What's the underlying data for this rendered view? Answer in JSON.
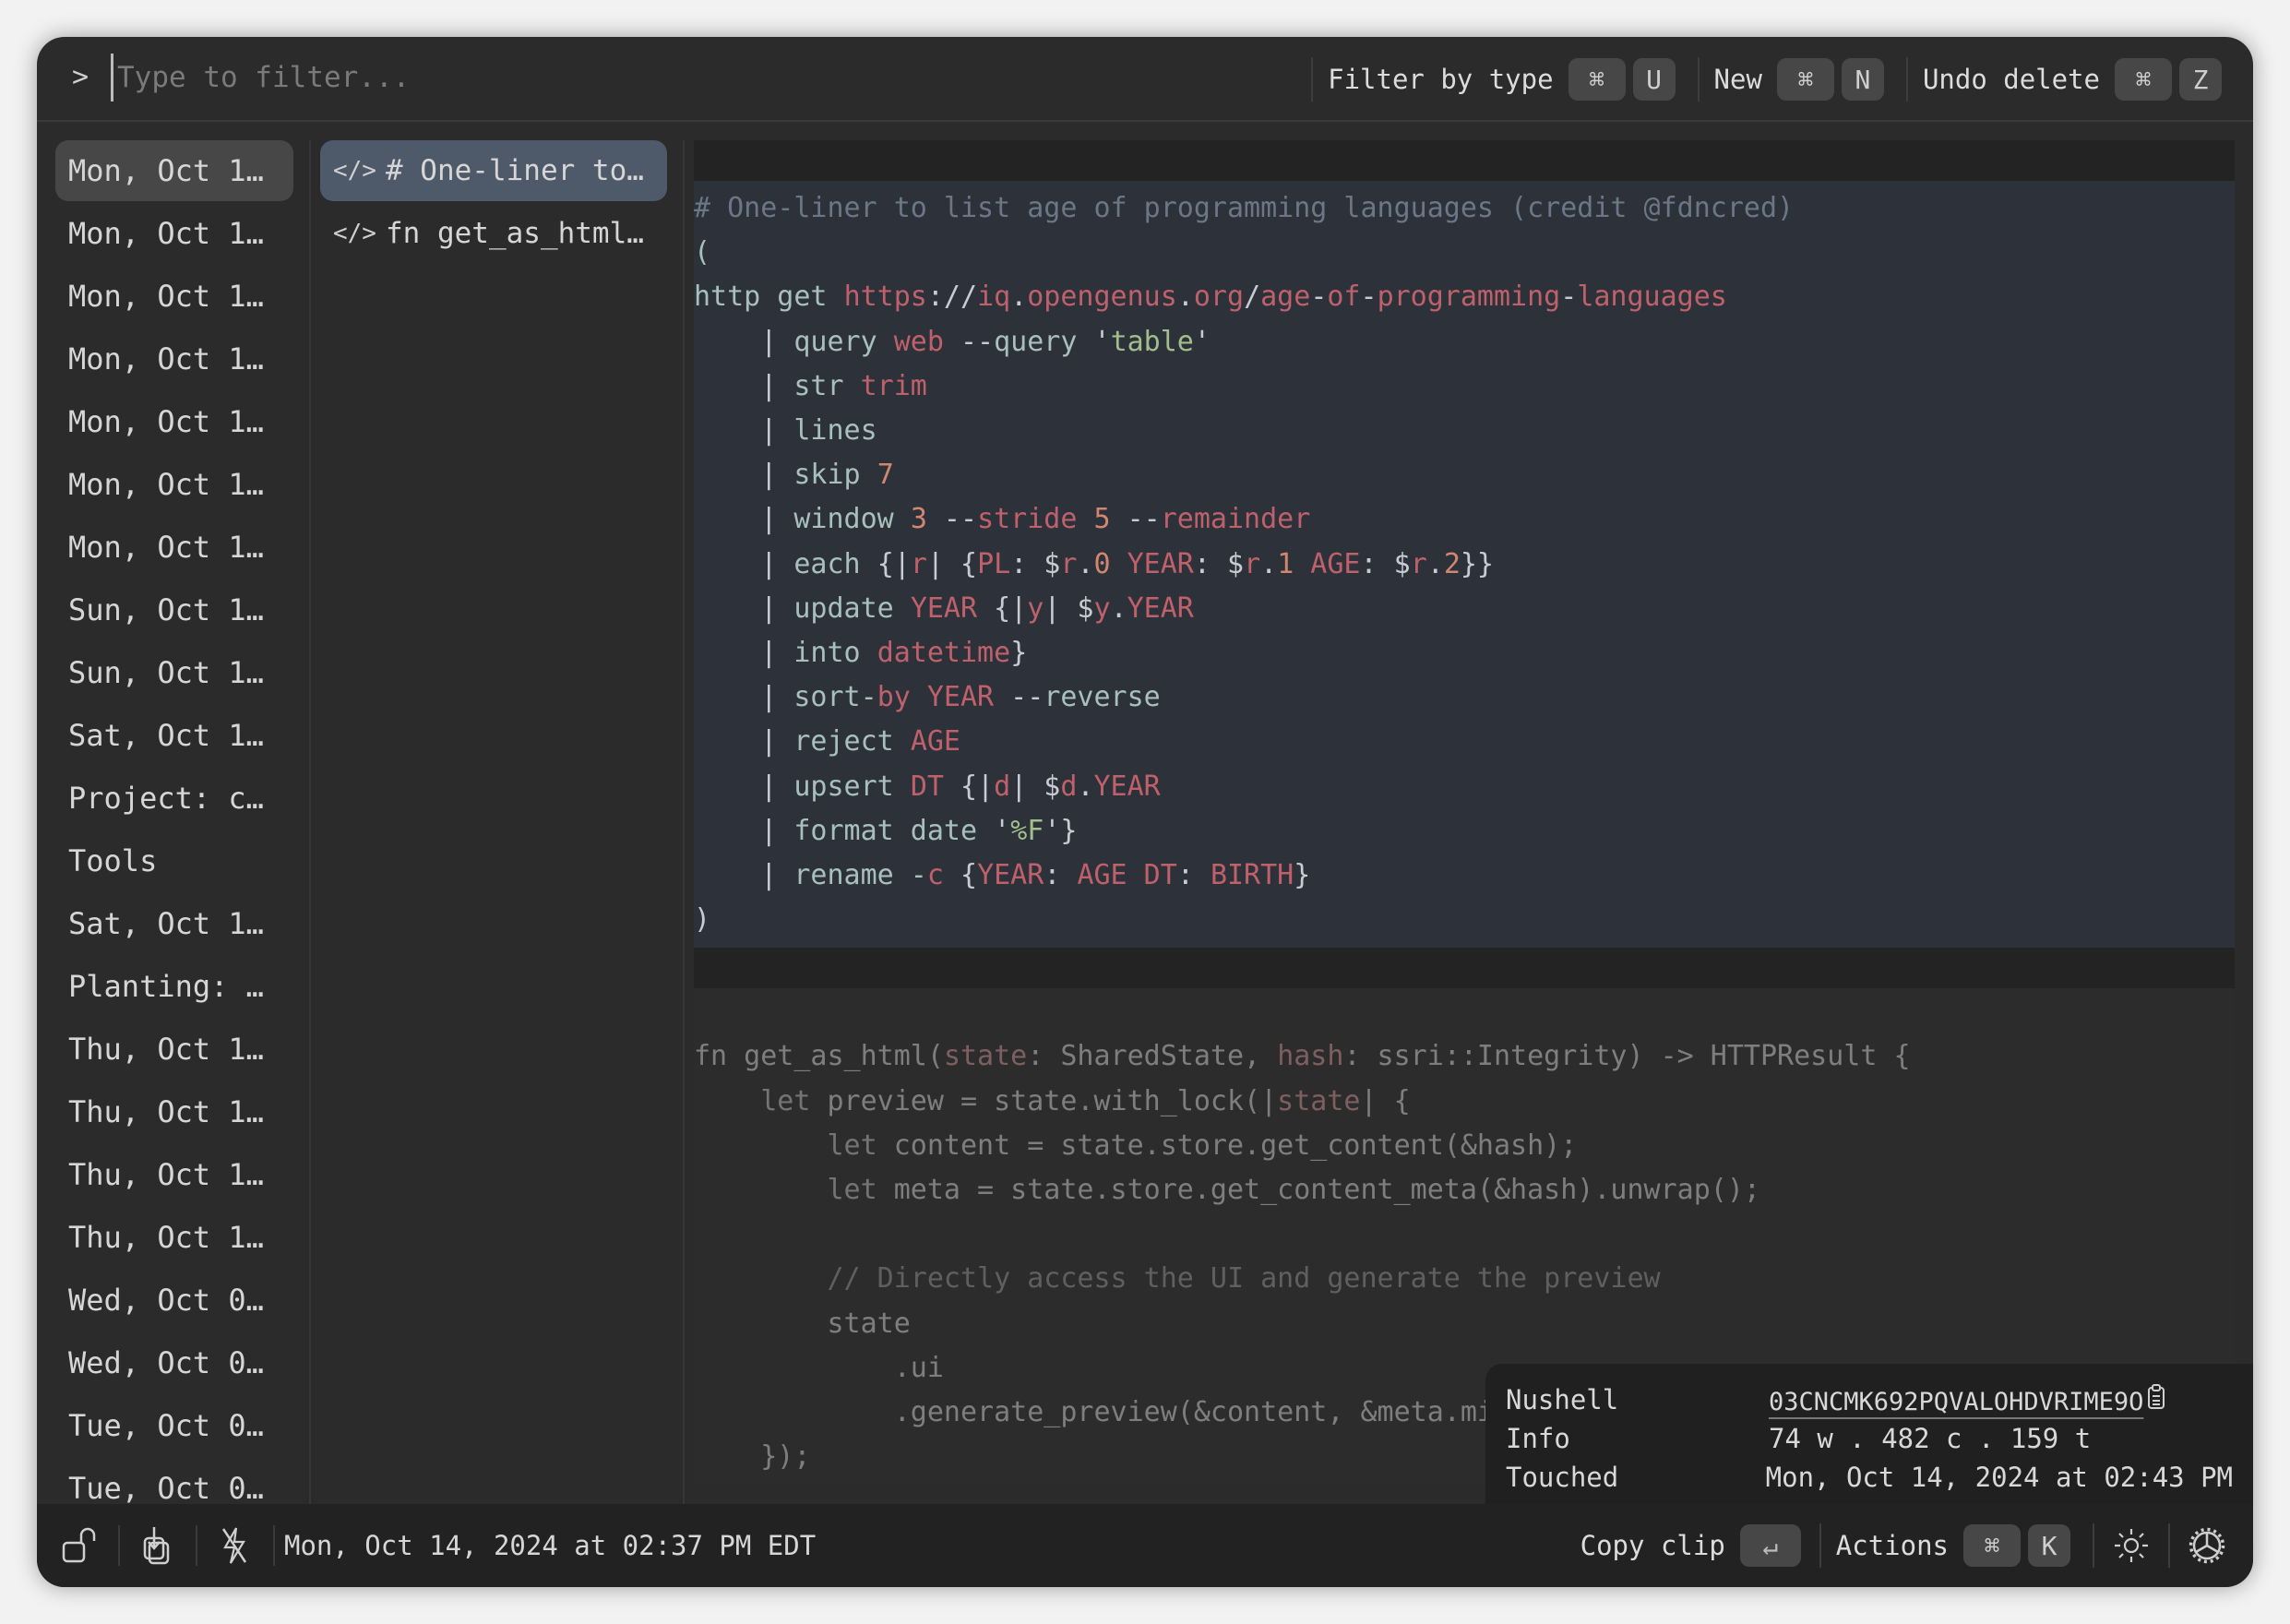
{
  "filter": {
    "prompt": ">",
    "placeholder": "Type to filter...",
    "value": ""
  },
  "top_actions": [
    {
      "label": "Filter by type",
      "keys": [
        "⌘",
        "U"
      ]
    },
    {
      "label": "New",
      "keys": [
        "⌘",
        "N"
      ]
    },
    {
      "label": "Undo delete",
      "keys": [
        "⌘",
        "Z"
      ]
    }
  ],
  "stacks": [
    {
      "label": "Mon, Oct 1…",
      "selected": true
    },
    {
      "label": "Mon, Oct 1…"
    },
    {
      "label": "Mon, Oct 1…"
    },
    {
      "label": "Mon, Oct 1…"
    },
    {
      "label": "Mon, Oct 1…"
    },
    {
      "label": "Mon, Oct 1…"
    },
    {
      "label": "Mon, Oct 1…"
    },
    {
      "label": "Sun, Oct 1…"
    },
    {
      "label": "Sun, Oct 1…"
    },
    {
      "label": "Sat, Oct 1…"
    },
    {
      "label": "Project: c…"
    },
    {
      "label": "Tools"
    },
    {
      "label": "Sat, Oct 1…"
    },
    {
      "label": "Planting: …"
    },
    {
      "label": "Thu, Oct 1…"
    },
    {
      "label": "Thu, Oct 1…"
    },
    {
      "label": "Thu, Oct 1…"
    },
    {
      "label": "Thu, Oct 1…"
    },
    {
      "label": "Wed, Oct 0…"
    },
    {
      "label": "Wed, Oct 0…"
    },
    {
      "label": "Tue, Oct 0…"
    },
    {
      "label": "Tue, Oct 0…"
    }
  ],
  "clips": [
    {
      "icon": "code-icon",
      "glyph": "</>",
      "label": "# One-liner to…",
      "selected": true
    },
    {
      "icon": "code-icon",
      "glyph": "</>",
      "label": "fn get_as_html…"
    }
  ],
  "preview": {
    "block1_lines": [
      [
        [
          "c-cm",
          "# One-liner to list age of programming languages (credit @fdncred)"
        ]
      ],
      [
        [
          "",
          "("
        ]
      ],
      [
        [
          "",
          "http get "
        ],
        [
          "c-r",
          "https"
        ],
        [
          "c-w",
          "://"
        ],
        [
          "c-r",
          "iq"
        ],
        [
          "c-w",
          "."
        ],
        [
          "c-r",
          "opengenus"
        ],
        [
          "c-w",
          "."
        ],
        [
          "c-r",
          "org"
        ],
        [
          "c-w",
          "/"
        ],
        [
          "c-r",
          "age"
        ],
        [
          "c-w",
          "-"
        ],
        [
          "c-r",
          "of"
        ],
        [
          "c-w",
          "-"
        ],
        [
          "c-r",
          "programming"
        ],
        [
          "c-w",
          "-"
        ],
        [
          "c-r",
          "languages"
        ]
      ],
      [
        [
          "c-w",
          "    | "
        ],
        [
          "",
          "query "
        ],
        [
          "c-r",
          "web"
        ],
        [
          "c-w",
          " --"
        ],
        [
          "",
          "query "
        ],
        [
          "c-w",
          "'"
        ],
        [
          "c-g",
          "table"
        ],
        [
          "c-w",
          "'"
        ]
      ],
      [
        [
          "c-w",
          "    | "
        ],
        [
          "",
          "str "
        ],
        [
          "c-r",
          "trim"
        ]
      ],
      [
        [
          "c-w",
          "    | "
        ],
        [
          "",
          "lines"
        ]
      ],
      [
        [
          "c-w",
          "    | "
        ],
        [
          "",
          "skip "
        ],
        [
          "c-o",
          "7"
        ]
      ],
      [
        [
          "c-w",
          "    | "
        ],
        [
          "",
          "window "
        ],
        [
          "c-o",
          "3"
        ],
        [
          "c-w",
          " --"
        ],
        [
          "c-r",
          "stride "
        ],
        [
          "c-o",
          "5"
        ],
        [
          "c-w",
          " --"
        ],
        [
          "c-r",
          "remainder"
        ]
      ],
      [
        [
          "c-w",
          "    | "
        ],
        [
          "",
          "each "
        ],
        [
          "c-w",
          "{|"
        ],
        [
          "c-r",
          "r"
        ],
        [
          "c-w",
          "| {"
        ],
        [
          "c-r",
          "PL"
        ],
        [
          "c-w",
          ": $"
        ],
        [
          "c-r",
          "r"
        ],
        [
          "c-w",
          "."
        ],
        [
          "c-o",
          "0"
        ],
        [
          "c-r",
          " YEAR"
        ],
        [
          "c-w",
          ": $"
        ],
        [
          "c-r",
          "r"
        ],
        [
          "c-w",
          "."
        ],
        [
          "c-o",
          "1"
        ],
        [
          "c-r",
          " AGE"
        ],
        [
          "c-w",
          ": $"
        ],
        [
          "c-r",
          "r"
        ],
        [
          "c-w",
          "."
        ],
        [
          "c-o",
          "2"
        ],
        [
          "c-w",
          "}}"
        ]
      ],
      [
        [
          "c-w",
          "    | "
        ],
        [
          "",
          "update "
        ],
        [
          "c-r",
          "YEAR"
        ],
        [
          "c-w",
          " {|"
        ],
        [
          "c-r",
          "y"
        ],
        [
          "c-w",
          "| $"
        ],
        [
          "c-r",
          "y"
        ],
        [
          "c-w",
          "."
        ],
        [
          "c-r",
          "YEAR"
        ]
      ],
      [
        [
          "c-w",
          "    | "
        ],
        [
          "",
          "into "
        ],
        [
          "c-r",
          "datetime"
        ],
        [
          "c-w",
          "}"
        ]
      ],
      [
        [
          "c-w",
          "    | "
        ],
        [
          "",
          "sort-"
        ],
        [
          "c-r",
          "by YEAR"
        ],
        [
          "c-w",
          " --"
        ],
        [
          "",
          "reverse"
        ]
      ],
      [
        [
          "c-w",
          "    | "
        ],
        [
          "",
          "reject "
        ],
        [
          "c-r",
          "AGE"
        ]
      ],
      [
        [
          "c-w",
          "    | "
        ],
        [
          "",
          "upsert "
        ],
        [
          "c-r",
          "DT"
        ],
        [
          "c-w",
          " {|"
        ],
        [
          "c-r",
          "d"
        ],
        [
          "c-w",
          "| $"
        ],
        [
          "c-r",
          "d"
        ],
        [
          "c-w",
          "."
        ],
        [
          "c-r",
          "YEAR"
        ]
      ],
      [
        [
          "c-w",
          "    | "
        ],
        [
          "",
          "format date "
        ],
        [
          "c-w",
          "'"
        ],
        [
          "c-g",
          "%F"
        ],
        [
          "c-w",
          "'}"
        ]
      ],
      [
        [
          "c-w",
          "    | "
        ],
        [
          "",
          "rename -"
        ],
        [
          "c-r",
          "c"
        ],
        [
          "c-w",
          " {"
        ],
        [
          "c-r",
          "YEAR"
        ],
        [
          "c-w",
          ": "
        ],
        [
          "c-r",
          "AGE DT"
        ],
        [
          "c-w",
          ": "
        ],
        [
          "c-r",
          "BIRTH"
        ],
        [
          "c-w",
          "}"
        ]
      ],
      [
        [
          "c-w",
          ")"
        ]
      ]
    ],
    "block2_lines": [
      [
        [
          "c-d",
          "fn get_as_html("
        ],
        [
          "c-p",
          "state"
        ],
        [
          "c-d",
          ": SharedState, "
        ],
        [
          "c-p",
          "hash"
        ],
        [
          "c-d",
          ": ssri::Integrity) -> HTTPResult {"
        ]
      ],
      [
        [
          "c-k",
          "    let "
        ],
        [
          "c-d",
          "preview = state.with_lock(|"
        ],
        [
          "c-p",
          "state"
        ],
        [
          "c-d",
          "| {"
        ]
      ],
      [
        [
          "c-k",
          "        let "
        ],
        [
          "c-d",
          "content = state.store.get_content(&hash);"
        ]
      ],
      [
        [
          "c-k",
          "        let "
        ],
        [
          "c-d",
          "meta = state.store.get_content_meta(&hash).unwrap();"
        ]
      ],
      [
        [
          "c-d",
          " "
        ]
      ],
      [
        [
          "c-cm2",
          "        // Directly access the UI and generate the preview"
        ]
      ],
      [
        [
          "c-d",
          "        state"
        ]
      ],
      [
        [
          "c-d",
          "            .ui"
        ]
      ],
      [
        [
          "c-d",
          "            .generate_preview(&content, &meta.mime_type, &meta"
        ]
      ],
      [
        [
          "c-d",
          "    });"
        ]
      ]
    ]
  },
  "info": {
    "rows": [
      {
        "key": "Nushell",
        "value": "03CNCMK692PQVALOHDVRIME9O"
      },
      {
        "key": "Info",
        "value": "74 w . 482 c . 159 t"
      },
      {
        "key": "Touched",
        "value": "Mon, Oct 14, 2024 at 02:43 PM"
      }
    ]
  },
  "footer": {
    "timestamp": "Mon, Oct 14, 2024 at 02:37 PM EDT",
    "copy_label": "Copy clip",
    "copy_key": "↵",
    "actions_label": "Actions",
    "actions_keys": [
      "⌘",
      "K"
    ],
    "icons": [
      "lock-open-icon",
      "download-stack-icon",
      "flash-off-icon",
      "sun-icon",
      "gear-icon"
    ]
  }
}
